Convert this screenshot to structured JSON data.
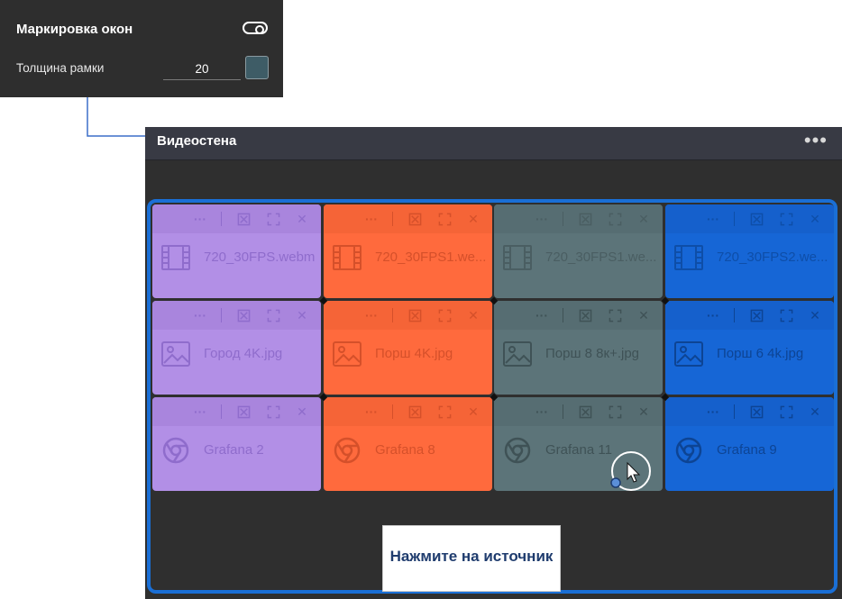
{
  "settings": {
    "title": "Маркировка окон",
    "thickness_label": "Толщина рамки",
    "thickness_value": "20",
    "swatch_color": "#3e5c66",
    "toggle_on": true
  },
  "videowall": {
    "title": "Видеостена",
    "menu_label": "•••",
    "frame_color": "#1a6fd6"
  },
  "tile_buttons": {
    "more": "···",
    "close": "✕"
  },
  "tiles": [
    {
      "name": "720_30FPS.webm",
      "type": "video",
      "color": "#b28fe6",
      "bar": "#a985dd",
      "fg": "#8f6ccc"
    },
    {
      "name": "720_30FPS1.we...",
      "type": "video",
      "color": "#ff6a3d",
      "bar": "#f56437",
      "fg": "#d5502a"
    },
    {
      "name": "720_30FPS1.we...",
      "type": "video",
      "color": "#5c7479",
      "bar": "#566d72",
      "fg": "#4a5e62"
    },
    {
      "name": "720_30FPS2.we...",
      "type": "video",
      "color": "#1666d6",
      "bar": "#1560cc",
      "fg": "#0e4ea8"
    },
    {
      "name": "Город 4K.jpg",
      "type": "image",
      "color": "#b28fe6",
      "bar": "#a985dd",
      "fg": "#8f6ccc"
    },
    {
      "name": "Порш 4K.jpg",
      "type": "image",
      "color": "#ff6a3d",
      "bar": "#f56437",
      "fg": "#d5502a"
    },
    {
      "name": "Порш 8 8к+.jpg",
      "type": "image",
      "color": "#5c7479",
      "bar": "#566d72",
      "fg": "#3f5256"
    },
    {
      "name": "Порш 6 4k.jpg",
      "type": "image",
      "color": "#1666d6",
      "bar": "#1560cc",
      "fg": "#0d4494"
    },
    {
      "name": "Grafana 2",
      "type": "browser",
      "color": "#b28fe6",
      "bar": "#a985dd",
      "fg": "#8f6ccc"
    },
    {
      "name": "Grafana 8",
      "type": "browser",
      "color": "#ff6a3d",
      "bar": "#f56437",
      "fg": "#d5502a"
    },
    {
      "name": "Grafana 11",
      "type": "browser",
      "color": "#5c7479",
      "bar": "#566d72",
      "fg": "#3f5256"
    },
    {
      "name": "Grafana 9",
      "type": "browser",
      "color": "#1666d6",
      "bar": "#1560cc",
      "fg": "#0d4494"
    }
  ],
  "callout": {
    "text": "Нажмите на источник"
  }
}
